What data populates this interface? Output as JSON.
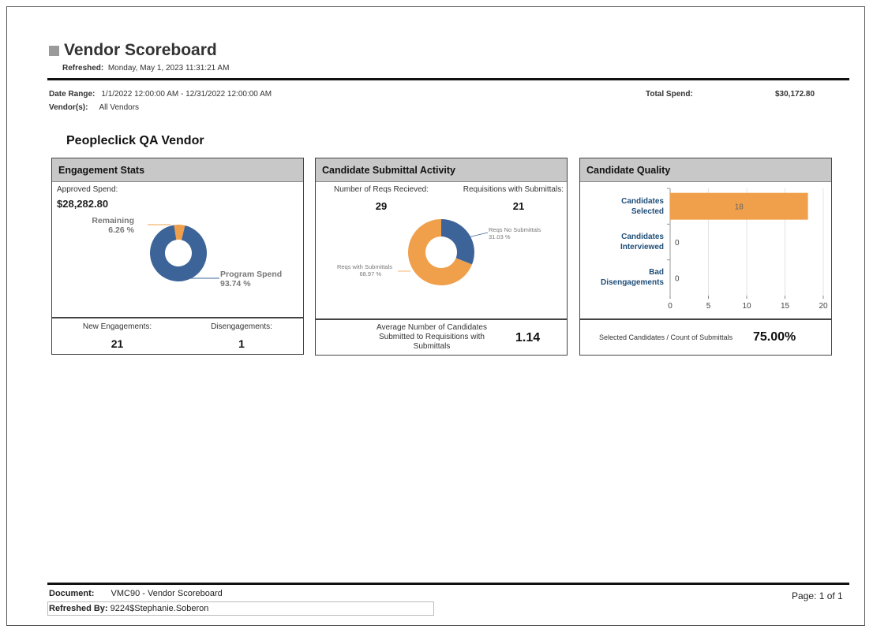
{
  "report": {
    "title": "Vendor Scoreboard",
    "refreshed_label": "Refreshed:",
    "refreshed_value": "Monday, May 1, 2023  11:31:21 AM"
  },
  "filters": {
    "date_range_label": "Date Range:",
    "date_range_value": "1/1/2022 12:00:00 AM - 12/31/2022 12:00:00 AM",
    "vendors_label": "Vendor(s):",
    "vendors_value": "All Vendors",
    "total_spend_label": "Total Spend:",
    "total_spend_value": "$30,172.80"
  },
  "vendor_name": "Peopleclick QA Vendor",
  "engagement": {
    "header": "Engagement Stats",
    "approved_label": "Approved Spend:",
    "approved_value": "$28,282.80",
    "remaining_label": "Remaining",
    "remaining_pct": "6.26 %",
    "program_label": "Program Spend",
    "program_pct": "93.74 %",
    "new_label": "New Engagements:",
    "new_value": "21",
    "dis_label": "Disengagements:",
    "dis_value": "1",
    "colors": {
      "program": "#3d6499",
      "remaining": "#f0a04b"
    }
  },
  "submittal": {
    "header": "Candidate Submittal Activity",
    "reqs_received_label": "Number of Reqs Recieved:",
    "reqs_received_value": "29",
    "reqs_with_sub_label": "Requisitions with Submittals:",
    "reqs_with_sub_value": "21",
    "no_sub_label": "Reqs No Submittals",
    "no_sub_pct": "31.03 %",
    "with_sub_label": "Reqs with Submittals",
    "with_sub_pct": "68.97 %",
    "avg_label": "Average Number of Candidates Submitted to Requisitions with Submittals",
    "avg_value": "1.14",
    "colors": {
      "with": "#f0a04b",
      "without": "#3d6499"
    }
  },
  "quality": {
    "header": "Candidate Quality",
    "ratio_label": "Selected Candidates / Count of Submittals",
    "ratio_value": "75.00%",
    "bar_color": "#f0a04b"
  },
  "chart_data": [
    {
      "type": "pie",
      "categories": [
        "Program Spend",
        "Remaining"
      ],
      "values": [
        93.74,
        6.26
      ]
    },
    {
      "type": "pie",
      "categories": [
        "Reqs No Submittals",
        "Reqs with Submittals"
      ],
      "values": [
        31.03,
        68.97
      ]
    },
    {
      "type": "bar",
      "orientation": "horizontal",
      "categories": [
        "Candidates Selected",
        "Candidates Interviewed",
        "Bad Disengagements"
      ],
      "category_lines": [
        [
          "Candidates",
          "Selected"
        ],
        [
          "Candidates",
          "Interviewed"
        ],
        [
          "Bad",
          "Disengagements"
        ]
      ],
      "values": [
        18,
        0,
        0
      ],
      "xlim": [
        0,
        20
      ],
      "xticks": [
        "0",
        "5",
        "10",
        "15",
        "20"
      ],
      "grid": true
    }
  ],
  "footer": {
    "document_label": "Document:",
    "document_value": "VMC90 - Vendor Scoreboard",
    "refreshed_by_label": "Refreshed By:",
    "refreshed_by_value": "9224$Stephanie.Soberon",
    "page": "Page: 1 of 1"
  }
}
